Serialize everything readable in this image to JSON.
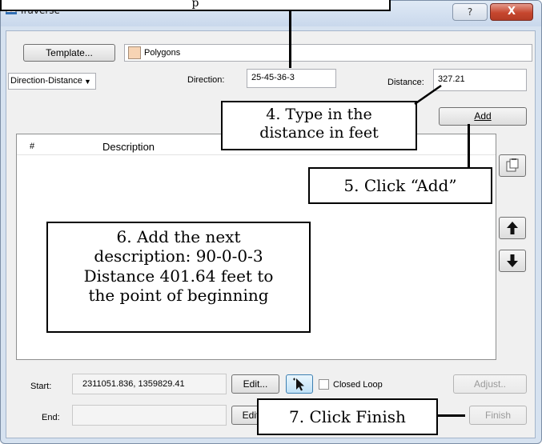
{
  "window": {
    "title": "Traverse",
    "help_label": "?",
    "close_label": "X"
  },
  "template": {
    "button_label": "Template...",
    "value": "Polygons",
    "swatch_color": "#f7d4b4"
  },
  "direction_mode": {
    "selected": "Direction-Distance"
  },
  "direction": {
    "label": "Direction:",
    "value": "25-45-36-3"
  },
  "distance": {
    "label": "Distance:",
    "value": "327.21"
  },
  "add_button": {
    "label": "Add"
  },
  "table": {
    "columns": [
      "#",
      "Description"
    ],
    "rows": []
  },
  "side_buttons": {
    "copy_icon": "clipboard-icon",
    "up_icon": "arrow-up-icon",
    "down_icon": "arrow-down-icon"
  },
  "start": {
    "label": "Start:",
    "value": "2311051.836, 1359829.41"
  },
  "end": {
    "label": "End:",
    "value": ""
  },
  "edit_start_label": "Edit...",
  "edit_end_label": "Edit",
  "closed_loop": {
    "label": "Closed Loop",
    "checked": false
  },
  "adjust_label": "Adjust..",
  "finish_label": "Finish",
  "callouts": {
    "top_partial": "p",
    "type_distance": [
      "4. Type in the",
      "distance in feet"
    ],
    "click_add": "5. Click “Add”",
    "next_description": [
      "6. Add the next",
      "description: 90-0-0-3",
      "Distance 401.64 feet to",
      "the point of beginning"
    ],
    "click_finish": "7. Click Finish"
  }
}
